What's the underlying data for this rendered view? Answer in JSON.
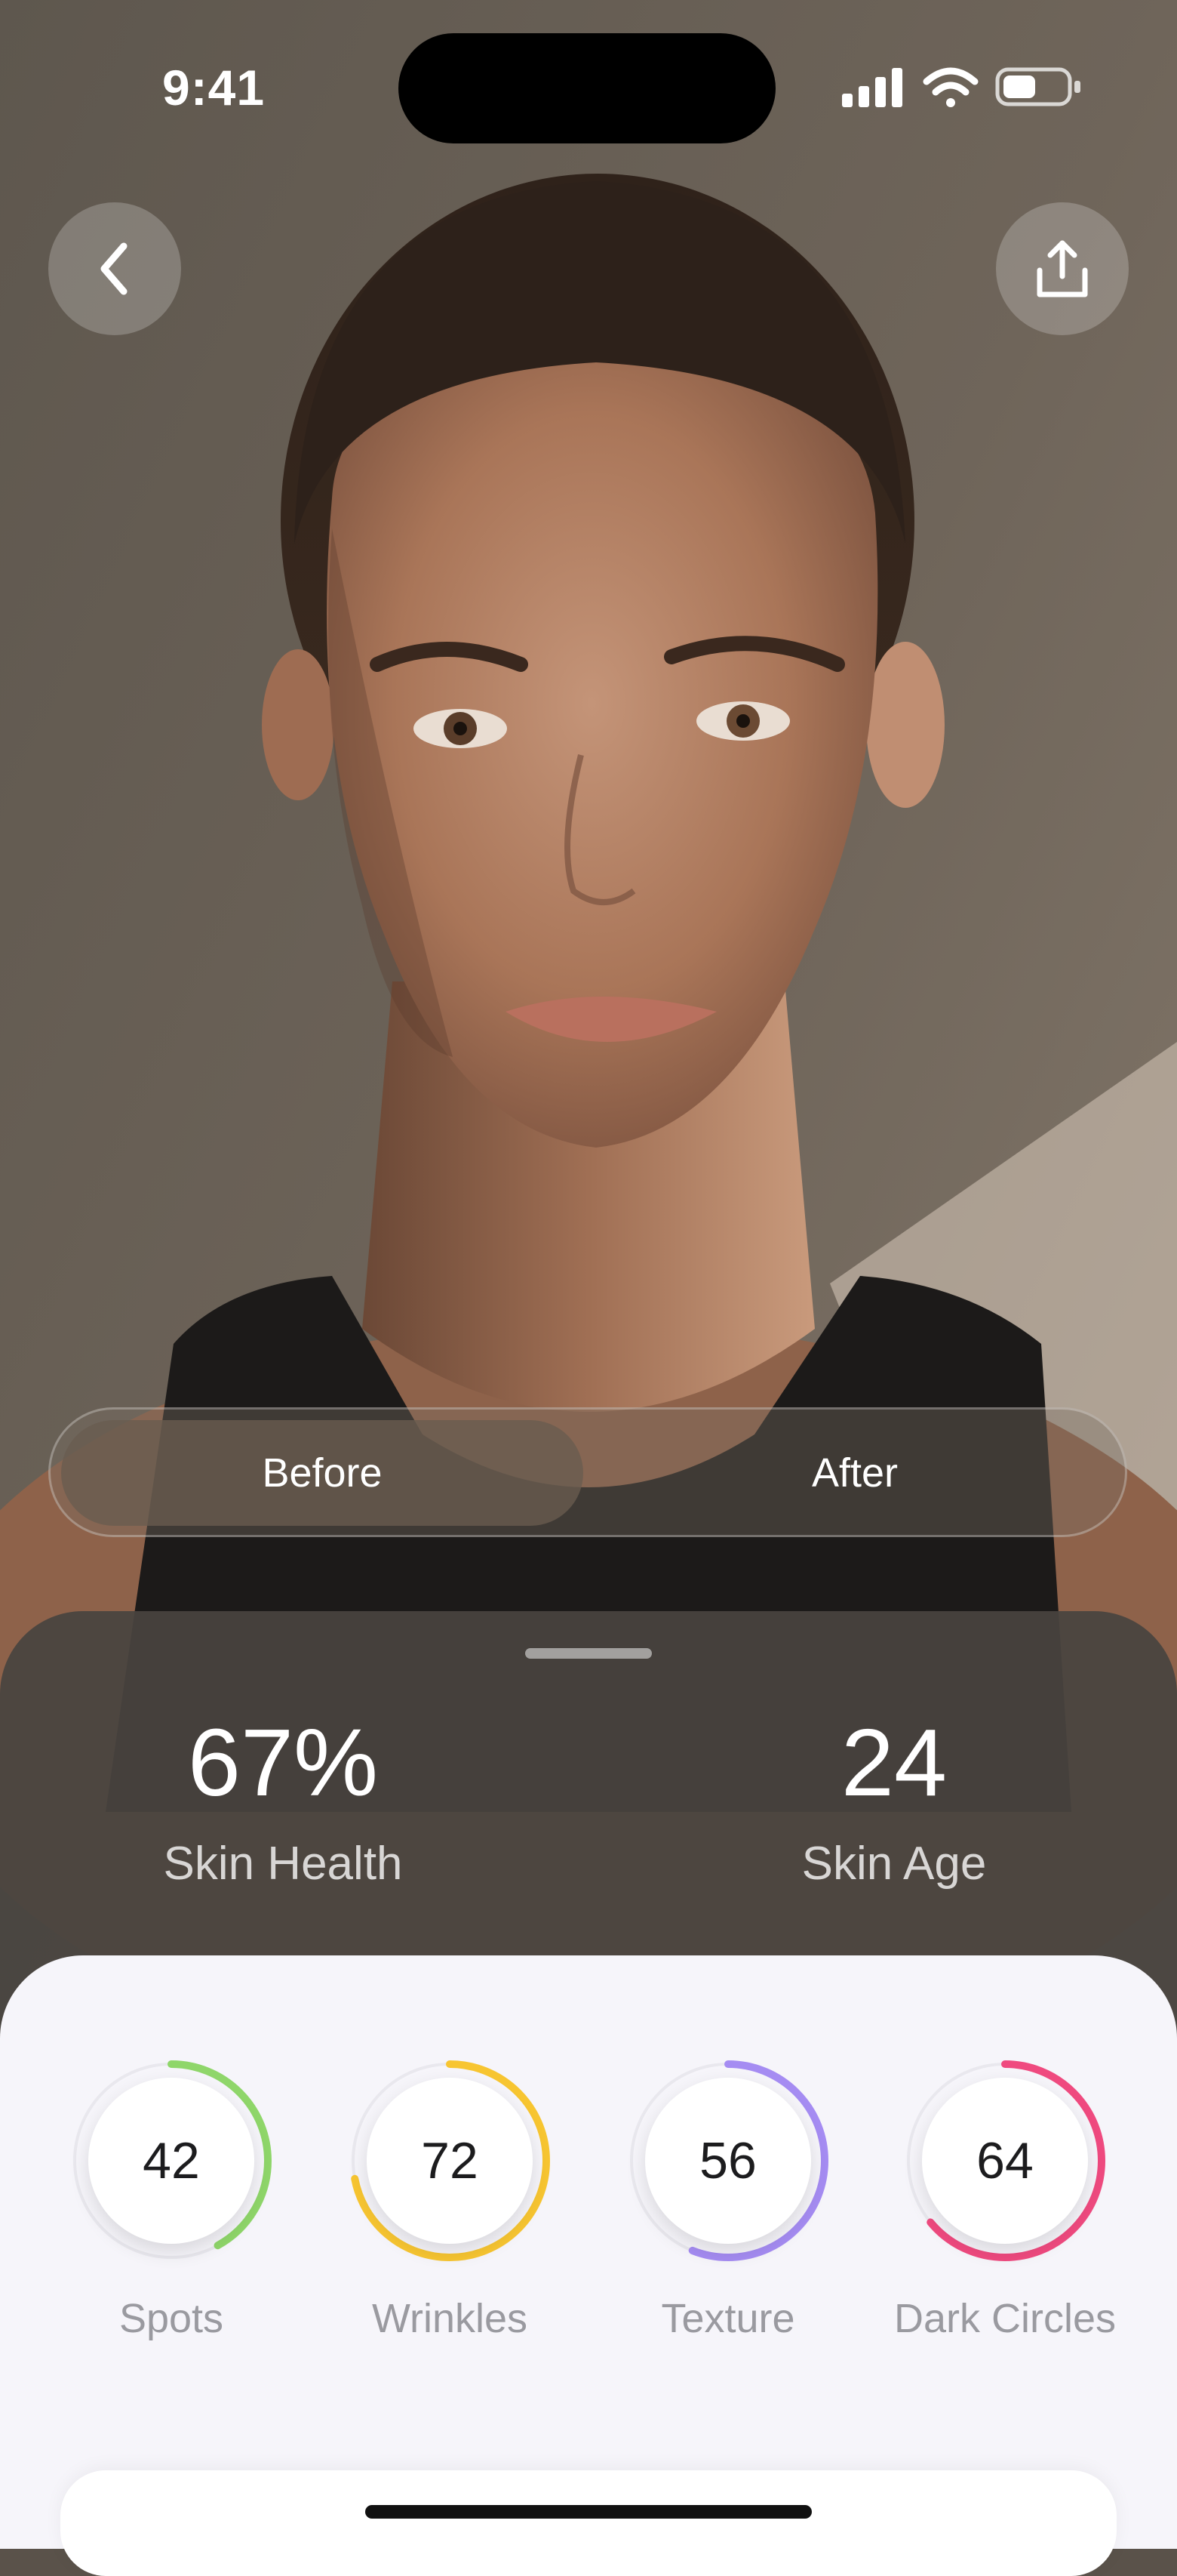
{
  "status_bar": {
    "time": "9:41",
    "icons": [
      "signal-icon",
      "wifi-icon",
      "battery-icon"
    ]
  },
  "header": {
    "back_icon": "chevron-left-icon",
    "share_icon": "share-icon"
  },
  "toggle": {
    "options": [
      "Before",
      "After"
    ],
    "selected": "Before"
  },
  "summary": {
    "skin_health": {
      "value": "67%",
      "label": "Skin Health"
    },
    "skin_age": {
      "value": "24",
      "label": "Skin Age"
    }
  },
  "metrics": [
    {
      "value": "42",
      "label": "Spots",
      "score": 42,
      "color": "#8fd66a"
    },
    {
      "value": "72",
      "label": "Wrinkles",
      "score": 72,
      "color": "#f7c531"
    },
    {
      "value": "56",
      "label": "Texture",
      "score": 56,
      "color": "#a58cf2"
    },
    {
      "value": "64",
      "label": "Dark Circles",
      "score": 64,
      "color": "#ef4a7f"
    }
  ]
}
